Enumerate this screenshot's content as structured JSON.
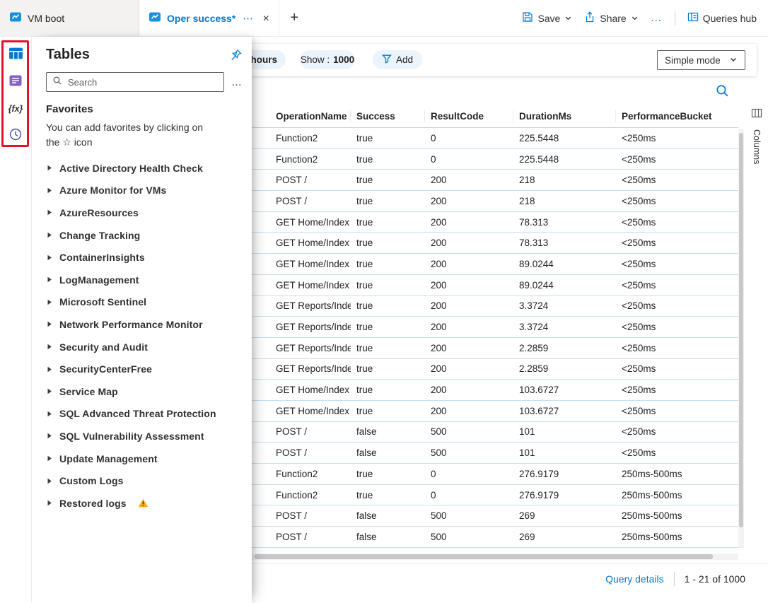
{
  "topbar": {
    "tabs": [
      {
        "label": "VM boot",
        "active": false
      },
      {
        "label": "Oper success*",
        "active": true
      }
    ],
    "save_label": "Save",
    "share_label": "Share",
    "more_glyph": "…",
    "queries_hub_label": "Queries hub"
  },
  "icons": {
    "tab_more": "⋯",
    "tab_close": "✕",
    "new_tab": "+",
    "panel_more": "…",
    "functions_glyph": "{fx}"
  },
  "tables_panel": {
    "title": "Tables",
    "search_placeholder": "Search",
    "favorites_title": "Favorites",
    "favorites_hint_line1": "You can add favorites by clicking on",
    "favorites_hint_line2": "the ☆ icon",
    "groups": [
      {
        "label": "Active Directory Health Check",
        "warning": false
      },
      {
        "label": "Azure Monitor for VMs",
        "warning": false
      },
      {
        "label": "AzureResources",
        "warning": false
      },
      {
        "label": "Change Tracking",
        "warning": false
      },
      {
        "label": "ContainerInsights",
        "warning": false
      },
      {
        "label": "LogManagement",
        "warning": false
      },
      {
        "label": "Microsoft Sentinel",
        "warning": false
      },
      {
        "label": "Network Performance Monitor",
        "warning": false
      },
      {
        "label": "Security and Audit",
        "warning": false
      },
      {
        "label": "SecurityCenterFree",
        "warning": false
      },
      {
        "label": "Service Map",
        "warning": false
      },
      {
        "label": "SQL Advanced Threat Protection",
        "warning": false
      },
      {
        "label": "SQL Vulnerability Assessment",
        "warning": false
      },
      {
        "label": "Update Management",
        "warning": false
      },
      {
        "label": "Custom Logs",
        "warning": false
      },
      {
        "label": "Restored logs",
        "warning": true
      }
    ]
  },
  "toolbar": {
    "time_fragment": "hours",
    "show_label": "Show :",
    "show_value": "1000",
    "add_label": "Add",
    "mode_label": "Simple mode"
  },
  "results": {
    "columns": [
      "OperationName",
      "Success",
      "ResultCode",
      "DurationMs",
      "PerformanceBucket"
    ],
    "rows": [
      [
        "Function2",
        "true",
        "0",
        "225.5448",
        "<250ms"
      ],
      [
        "Function2",
        "true",
        "0",
        "225.5448",
        "<250ms"
      ],
      [
        "POST /",
        "true",
        "200",
        "218",
        "<250ms"
      ],
      [
        "POST /",
        "true",
        "200",
        "218",
        "<250ms"
      ],
      [
        "GET Home/Index",
        "true",
        "200",
        "78.313",
        "<250ms"
      ],
      [
        "GET Home/Index",
        "true",
        "200",
        "78.313",
        "<250ms"
      ],
      [
        "GET Home/Index",
        "true",
        "200",
        "89.0244",
        "<250ms"
      ],
      [
        "GET Home/Index",
        "true",
        "200",
        "89.0244",
        "<250ms"
      ],
      [
        "GET Reports/Index",
        "true",
        "200",
        "3.3724",
        "<250ms"
      ],
      [
        "GET Reports/Index",
        "true",
        "200",
        "3.3724",
        "<250ms"
      ],
      [
        "GET Reports/Index",
        "true",
        "200",
        "2.2859",
        "<250ms"
      ],
      [
        "GET Reports/Index",
        "true",
        "200",
        "2.2859",
        "<250ms"
      ],
      [
        "GET Home/Index",
        "true",
        "200",
        "103.6727",
        "<250ms"
      ],
      [
        "GET Home/Index",
        "true",
        "200",
        "103.6727",
        "<250ms"
      ],
      [
        "POST /",
        "false",
        "500",
        "101",
        "<250ms"
      ],
      [
        "POST /",
        "false",
        "500",
        "101",
        "<250ms"
      ],
      [
        "Function2",
        "true",
        "0",
        "276.9179",
        "250ms-500ms"
      ],
      [
        "Function2",
        "true",
        "0",
        "276.9179",
        "250ms-500ms"
      ],
      [
        "POST /",
        "false",
        "500",
        "269",
        "250ms-500ms"
      ],
      [
        "POST /",
        "false",
        "500",
        "269",
        "250ms-500ms"
      ]
    ],
    "columns_tab_label": "Columns",
    "footer": {
      "query_details": "Query details",
      "range": "1 - 21 of 1000"
    }
  },
  "colors": {
    "accent": "#0078d4",
    "annotation_red": "#e8112d",
    "warning": "#fcaa1b",
    "row_border": "#c5e0f5"
  }
}
